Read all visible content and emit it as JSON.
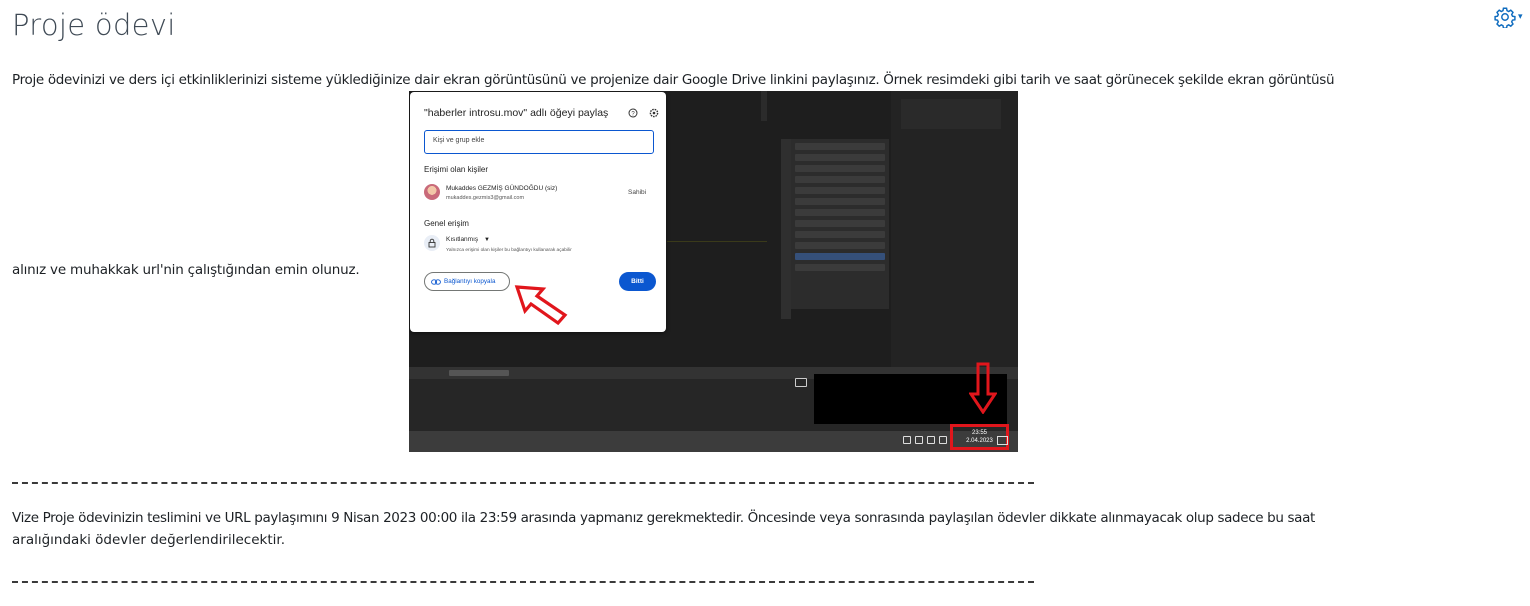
{
  "page": {
    "title": "Proje ödevi",
    "settings_icon": "gear-icon",
    "paragraph1_line1": "Proje ödevinizi ve ders içi etkinliklerinizi sisteme yüklediğinize dair ekran görüntüsünü ve projenize dair Google Drive linkini paylaşınız. Örnek resimdeki gibi tarih ve saat görünecek şekilde ekran görüntüsü",
    "paragraph1_line2": "alınız ve muhakkak url'nin çalıştığından emin olunuz.",
    "paragraph2_line1": "Vize Proje ödevinizin teslimini ve URL paylaşımını 9 Nisan 2023 00:00 ila 23:59 arasında yapmanız gerekmektedir. Öncesinde veya sonrasında paylaşılan ödevler dikkate alınmayacak olup sadece bu saat",
    "paragraph2_line2": "aralığındaki ödevler değerlendirilecektir."
  },
  "screenshot": {
    "dialog": {
      "title": "\"haberler introsu.mov\" adlı öğeyi paylaş",
      "add_placeholder": "Kişi ve grup ekle",
      "people_heading": "Erişimi olan kişiler",
      "user_name": "Mukaddes GEZMİŞ GÜNDOĞDU (siz)",
      "user_email": "mukaddes.gezmis3@gmail.com",
      "user_role": "Sahibi",
      "general_heading": "Genel erişim",
      "access_level": "Kısıtlanmış",
      "access_desc": "Yalnızca erişimi olan kişiler bu bağlantıyı kullanarak açabilir",
      "copy_link_label": "Bağlantıyı kopyala",
      "done_label": "Bitti"
    },
    "clock": {
      "time": "23:55",
      "date": "2.04.2023"
    },
    "highlight_color": "#e1161c",
    "accent_color": "#0b57d0"
  }
}
